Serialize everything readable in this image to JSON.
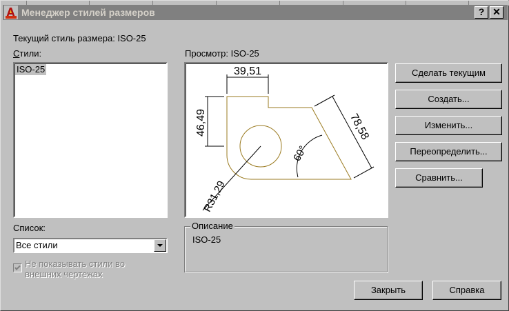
{
  "window": {
    "title": "Менеджер стилей размеров",
    "help_button": "?",
    "close_button": "✕"
  },
  "current_style_label": "Текущий стиль размера: ISO-25",
  "styles_label": "Стили:",
  "styles_list": [
    "ISO-25"
  ],
  "preview_label": "Просмотр: ISO-25",
  "preview": {
    "dim_top": "39,51",
    "dim_left": "46,49",
    "dim_diag": "78,58",
    "dim_angle": "60°",
    "dim_radius": "R31,29"
  },
  "buttons": {
    "set_current": "Сделать текущим",
    "create": "Создать...",
    "modify": "Изменить...",
    "override": "Переопределить...",
    "compare": "Сравнить...",
    "close": "Закрыть",
    "help": "Справка"
  },
  "list_label": "Список:",
  "list_filter": {
    "value": "Все стили"
  },
  "hide_xref": {
    "label": "Не показывать стили во внешних чертежах",
    "checked": true,
    "enabled": false
  },
  "description": {
    "title": "Описание",
    "text": "ISO-25"
  },
  "colors": {
    "face": "#c0c0c0",
    "title_inactive": "#808080",
    "drawing_outline": "#9a7a1f"
  }
}
